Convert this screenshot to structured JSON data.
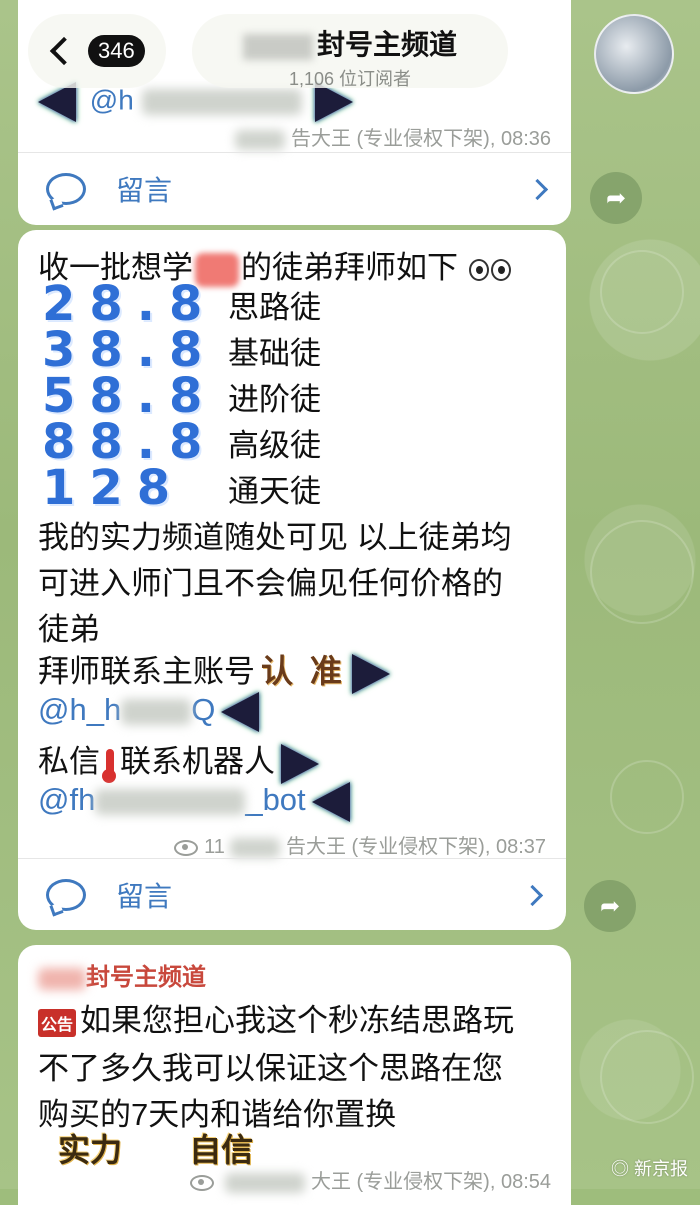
{
  "header": {
    "back_count": "346",
    "channel_title": "封号主频道",
    "subscribers": "1,106 位订阅者"
  },
  "post1": {
    "handle_fragment": "@h",
    "meta": "告大王 (专业侵权下架), 08:36",
    "comment_label": "留言"
  },
  "post2": {
    "intro_a": "收一批想学",
    "intro_b": "的徒弟拜师如下",
    "tiers": [
      {
        "price": "28.8",
        "label": "思路徒"
      },
      {
        "price": "38.8",
        "label": "基础徒"
      },
      {
        "price": "58.8",
        "label": "进阶徒"
      },
      {
        "price": "88.8",
        "label": "高级徒"
      },
      {
        "price": "128",
        "label": "通天徒"
      }
    ],
    "body_line1": "我的实力频道随处可见 以上徒弟均",
    "body_line2": "可进入师门且不会偏见任何价格的",
    "body_line3": "徒弟",
    "contact_line": "拜师联系主账号",
    "contact_highlight": "认 准",
    "handle1_a": "@h_h",
    "handle1_b": "Q",
    "dm_a": "私信",
    "dm_b": "联系机器人",
    "bot_a": "@fh",
    "bot_b": "_bot",
    "views": "11",
    "meta": "告大王 (专业侵权下架), 08:37",
    "comment_label": "留言"
  },
  "post3": {
    "channel": "封号主频道",
    "badge": "公告",
    "line1": "如果您担心我这个秒冻结思路玩",
    "line2": "不了多久我可以保证这个思路在您",
    "line3": "购买的7天内和谐给你置换",
    "tag1": "实力",
    "tag2": "自信",
    "meta": "大王 (专业侵权下架), 08:54"
  },
  "watermark": "新京报"
}
